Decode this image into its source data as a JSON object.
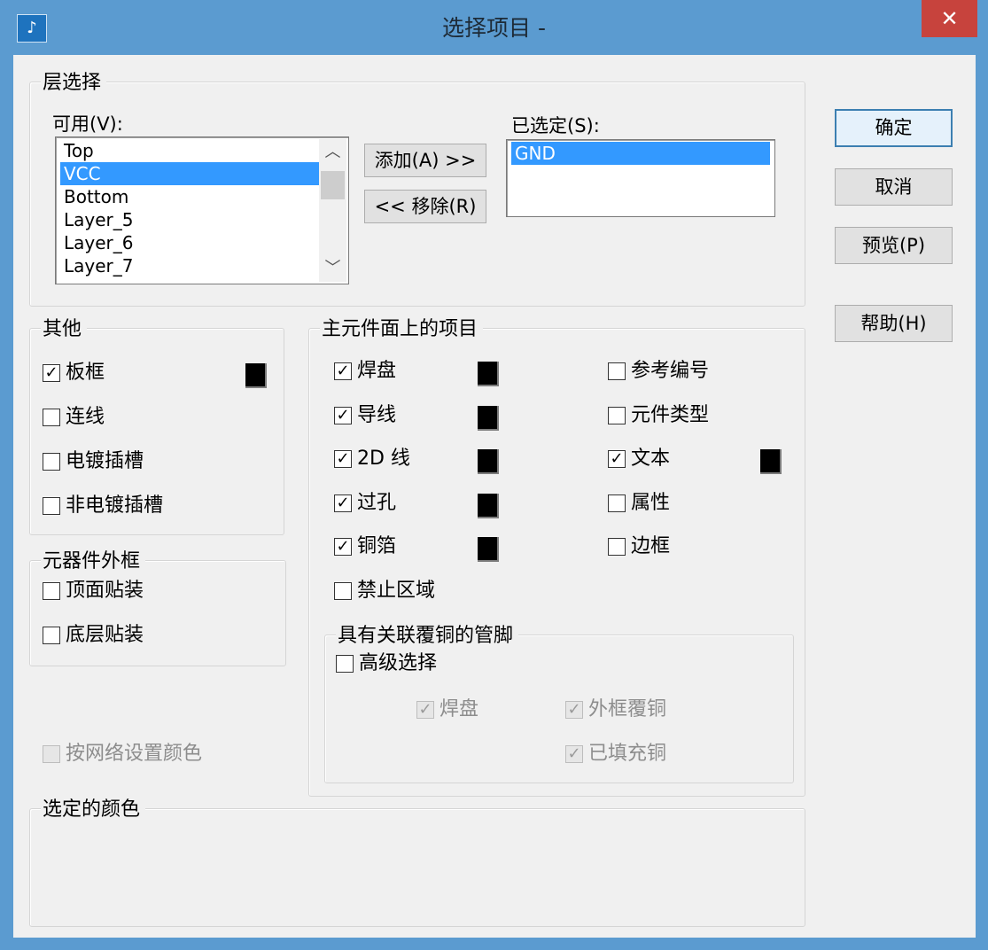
{
  "window": {
    "title": "选择项目 -",
    "icon": "app-icon",
    "close_glyph": "✕"
  },
  "colors": {
    "titlebar": "#5b9bd0",
    "close": "#c7433d",
    "selection": "#3399ff",
    "swatch": "#000000"
  },
  "layer_group": {
    "legend": "层选择",
    "available_label": "可用(V):",
    "available_items": [
      "Top",
      "VCC",
      "Bottom",
      "Layer_5",
      "Layer_6",
      "Layer_7"
    ],
    "available_selected": "VCC",
    "selected_label": "已选定(S):",
    "selected_items": [
      "GND"
    ],
    "add_button": "添加(A) >>",
    "remove_button": "<< 移除(R)"
  },
  "buttons": {
    "ok": "确定",
    "cancel": "取消",
    "preview": "预览(P)",
    "help": "帮助(H)"
  },
  "other_group": {
    "legend": "其他",
    "items": [
      {
        "label": "板框",
        "checked": true,
        "has_color": true
      },
      {
        "label": "连线",
        "checked": false
      },
      {
        "label": "电镀插槽",
        "checked": false
      },
      {
        "label": "非电镀插槽",
        "checked": false
      }
    ]
  },
  "outline_group": {
    "legend": "元器件外框",
    "items": [
      {
        "label": "顶面贴装",
        "checked": false
      },
      {
        "label": "底层贴装",
        "checked": false
      }
    ]
  },
  "net_color": {
    "label": "按网络设置颜色",
    "checked": false,
    "disabled": true
  },
  "primary_group": {
    "legend": "主元件面上的项目",
    "col1": [
      {
        "label": "焊盘",
        "checked": true,
        "has_color": true
      },
      {
        "label": "导线",
        "checked": true,
        "has_color": true
      },
      {
        "label": "2D 线",
        "checked": true,
        "has_color": true
      },
      {
        "label": "过孔",
        "checked": true,
        "has_color": true
      },
      {
        "label": "铜箔",
        "checked": true,
        "has_color": true
      },
      {
        "label": "禁止区域",
        "checked": false
      }
    ],
    "col2": [
      {
        "label": "参考编号",
        "checked": false
      },
      {
        "label": "元件类型",
        "checked": false
      },
      {
        "label": "文本",
        "checked": true,
        "has_color": true
      },
      {
        "label": "属性",
        "checked": false
      },
      {
        "label": "边框",
        "checked": false
      }
    ]
  },
  "pins_group": {
    "legend": "具有关联覆铜的管脚",
    "advanced": {
      "label": "高级选择",
      "checked": false
    },
    "pad": {
      "label": "焊盘",
      "checked": true,
      "disabled": true
    },
    "outline_copper": {
      "label": "外框覆铜",
      "checked": true,
      "disabled": true
    },
    "filled_copper": {
      "label": "已填充铜",
      "checked": true,
      "disabled": true
    }
  },
  "selected_color_group": {
    "legend": "选定的颜色"
  }
}
